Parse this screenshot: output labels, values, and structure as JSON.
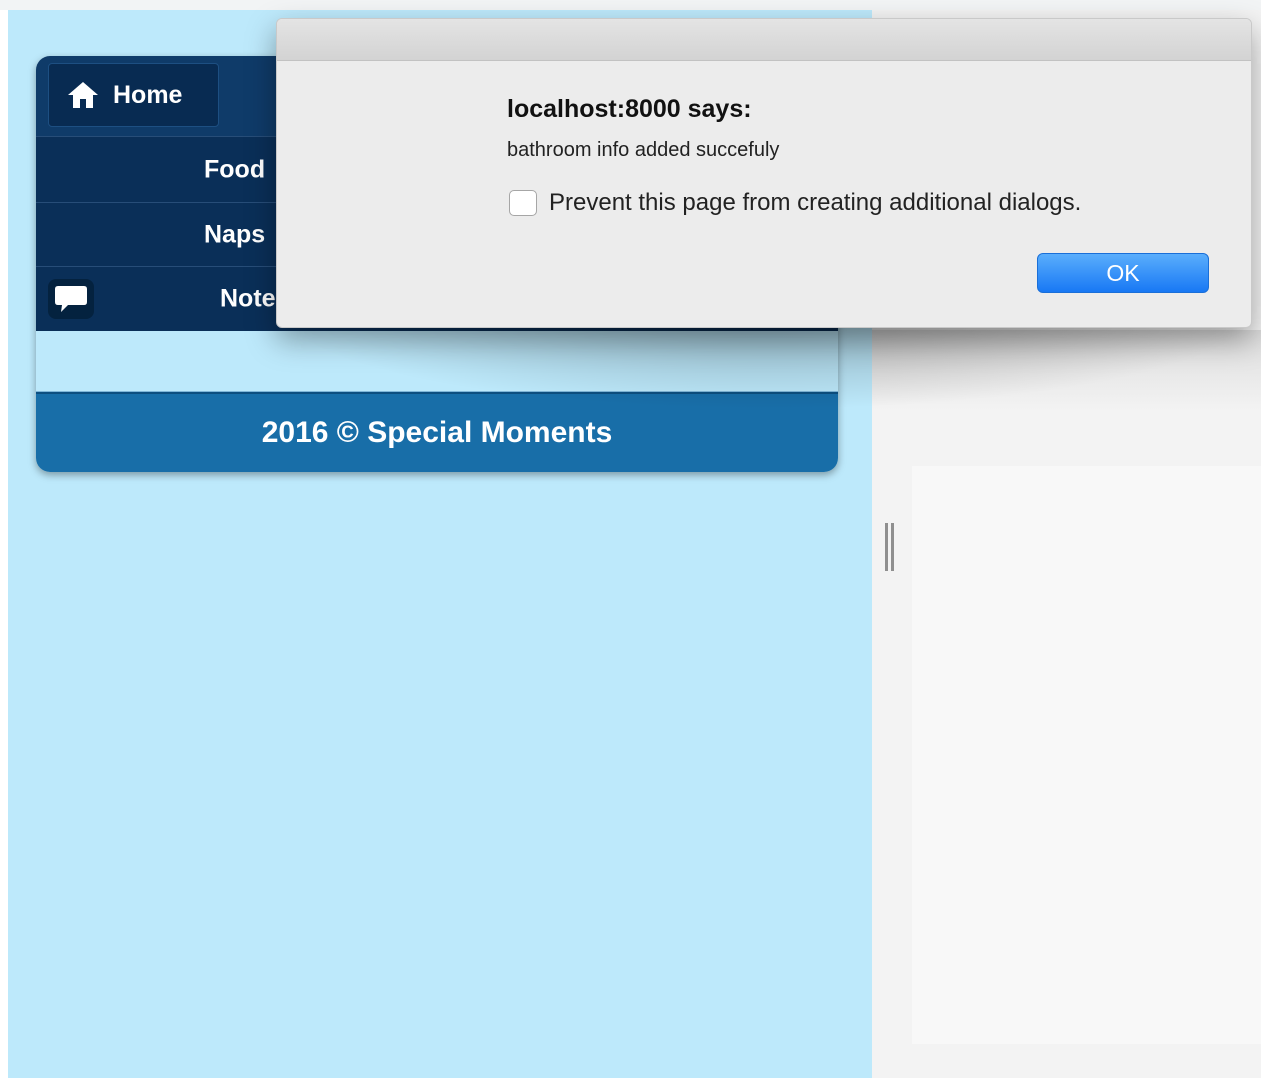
{
  "app": {
    "nav": {
      "home_label": "Home",
      "items": [
        {
          "label": "Food"
        },
        {
          "label": "Naps"
        },
        {
          "label": "Note"
        }
      ]
    },
    "footer_text": "2016 © Special Moments"
  },
  "dialog": {
    "title": "localhost:8000 says:",
    "message": "bathroom info added succefuly",
    "prevent_label": "Prevent this page from creating additional dialogs.",
    "prevent_checked": false,
    "ok_label": "OK"
  },
  "icons": {
    "home": "home-icon",
    "notes": "speech-bubble-icon"
  },
  "colors": {
    "nav_dark": "#0a2f58",
    "footer_blue": "#186ea8",
    "page_background": "#bde9fb",
    "ok_blue": "#1878f4"
  }
}
